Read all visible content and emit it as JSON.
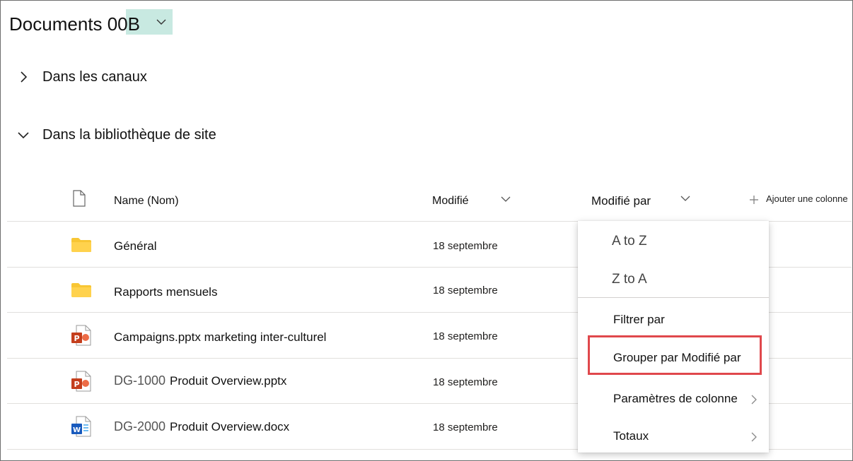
{
  "library": {
    "title": "Documents 00B"
  },
  "sections": [
    {
      "label": "Dans les canaux",
      "expanded": false
    },
    {
      "label": "Dans la bibliothèque de site",
      "expanded": true
    }
  ],
  "columns": {
    "name": "Name (Nom)",
    "modified": "Modifié",
    "modified_by": "Modifié par",
    "add_column": "Ajouter une colonne"
  },
  "files": [
    {
      "type": "folder",
      "prefix": "",
      "name": "Général",
      "modified": "18 septembre"
    },
    {
      "type": "folder",
      "prefix": "",
      "name": "Rapports mensuels",
      "modified": "18 septembre"
    },
    {
      "type": "pptx",
      "prefix": "",
      "name": "Campaigns.pptx marketing inter-culturel",
      "modified": "18 septembre"
    },
    {
      "type": "pptx",
      "prefix": "DG-1000",
      "name": "Produit Overview.pptx",
      "modified": "18 septembre"
    },
    {
      "type": "docx",
      "prefix": "DG-2000",
      "name": "Produit Overview.docx",
      "modified": "18 septembre"
    }
  ],
  "column_menu": {
    "sort_az": "A to Z",
    "sort_za": "Z to A",
    "filter": "Filtrer par",
    "group": "Grouper par Modifié par",
    "settings": "Paramètres de colonne",
    "totals": "Totaux"
  },
  "colors": {
    "title_highlight": "#c8e9e1",
    "folder": "#f8c634",
    "powerpoint": "#c43e1c",
    "word": "#185abd",
    "callout_border": "#e0484c"
  }
}
